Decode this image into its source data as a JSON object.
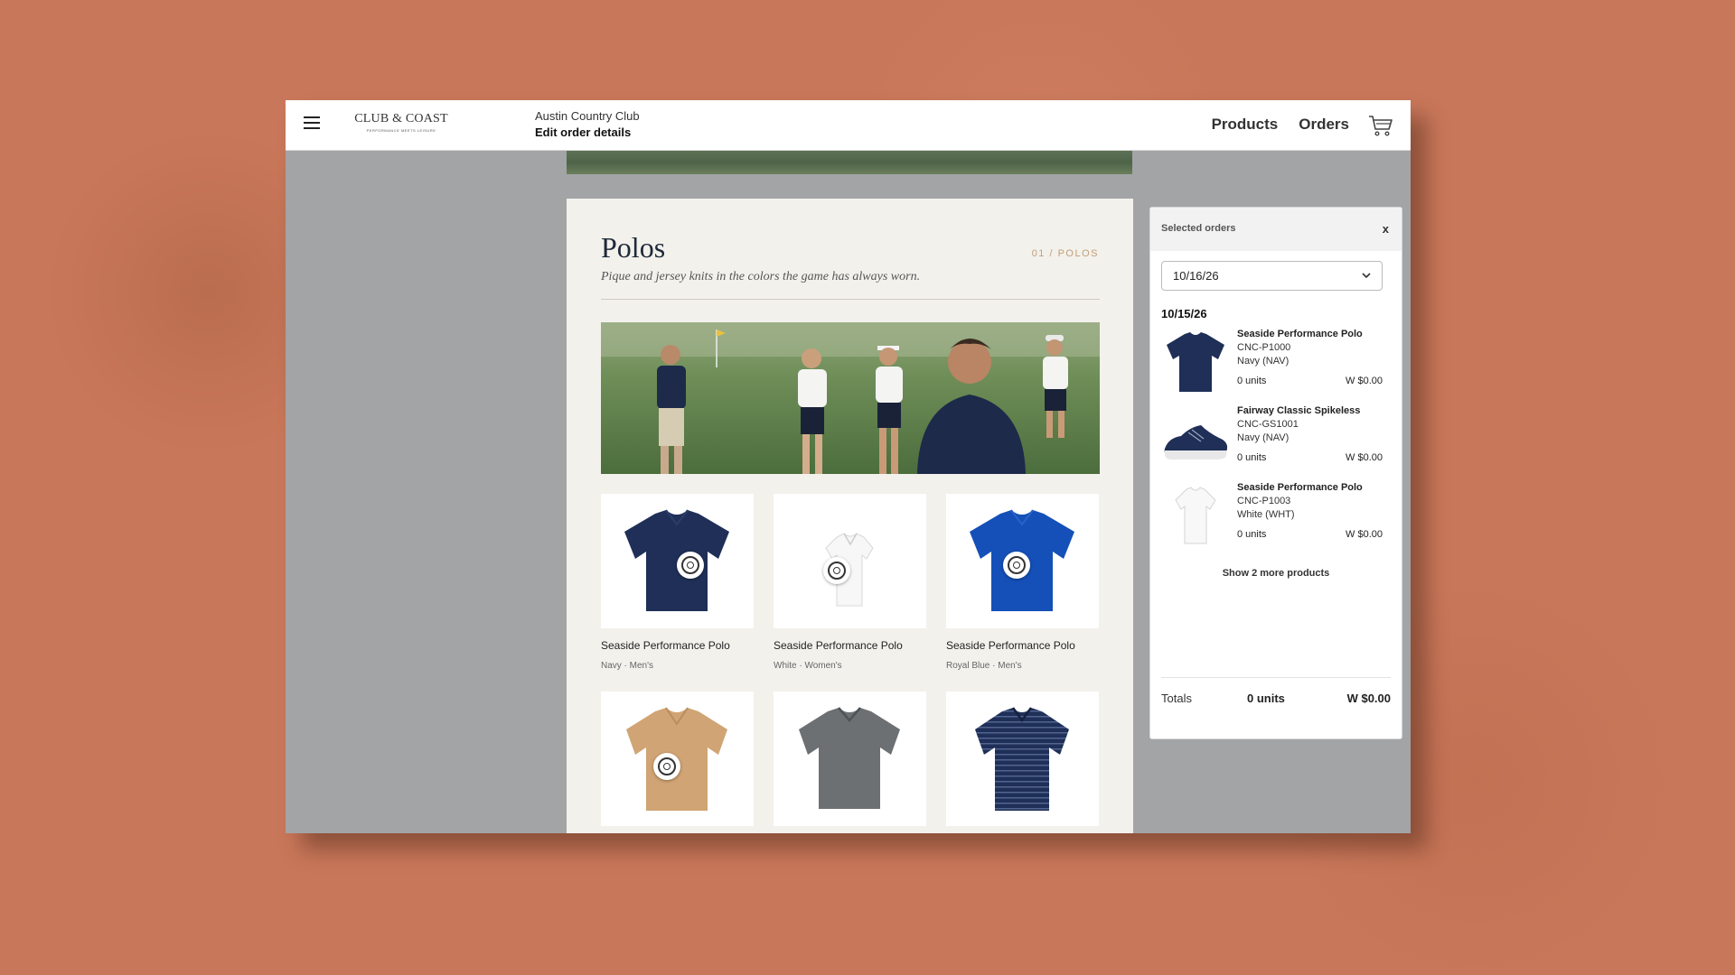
{
  "colors": {
    "wall": "#c9775a",
    "accent_gold": "#c2a077",
    "navy": "#1f2f57",
    "royal_blue": "#1450b8",
    "khaki": "#d0a474",
    "gray": "#6c7072"
  },
  "topbar": {
    "menu_icon": "hamburger-icon",
    "brand_name": "CLUB & COAST",
    "brand_tagline": "PERFORMANCE MEETS LEISURE",
    "club_name": "Austin Country Club",
    "club_action": "Edit order details",
    "nav": [
      "Products",
      "Orders"
    ],
    "cart_icon": "cart-icon"
  },
  "catalog": {
    "title": "Polos",
    "crumb": "01 / POLOS",
    "subtitle": "Pique and jersey knits in the colors the game has always worn.",
    "products": [
      {
        "name": "Seaside Performance Polo",
        "meta": "Navy · Men's"
      },
      {
        "name": "Seaside Performance Polo",
        "meta": "White · Women's"
      },
      {
        "name": "Seaside Performance Polo",
        "meta": "Royal Blue · Men's"
      },
      {
        "name": "",
        "meta": ""
      },
      {
        "name": "",
        "meta": ""
      },
      {
        "name": "",
        "meta": ""
      }
    ]
  },
  "panel": {
    "title": "Selected orders",
    "close": "x",
    "date_selected": "10/16/26",
    "group_date": "10/15/26",
    "items": [
      {
        "name": "Seaside Performance Polo",
        "sku": "CNC-P1000",
        "color": "Navy (NAV)",
        "units": "0 units",
        "price": "W $0.00"
      },
      {
        "name": "Fairway Classic Spikeless",
        "sku": "CNC-GS1001",
        "color": "Navy (NAV)",
        "units": "0 units",
        "price": "W $0.00"
      },
      {
        "name": "Seaside Performance Polo",
        "sku": "CNC-P1003",
        "color": "White (WHT)",
        "units": "0 units",
        "price": "W $0.00"
      }
    ],
    "show_more": "Show 2 more products",
    "totals": {
      "label": "Totals",
      "units": "0 units",
      "price": "W $0.00"
    }
  }
}
